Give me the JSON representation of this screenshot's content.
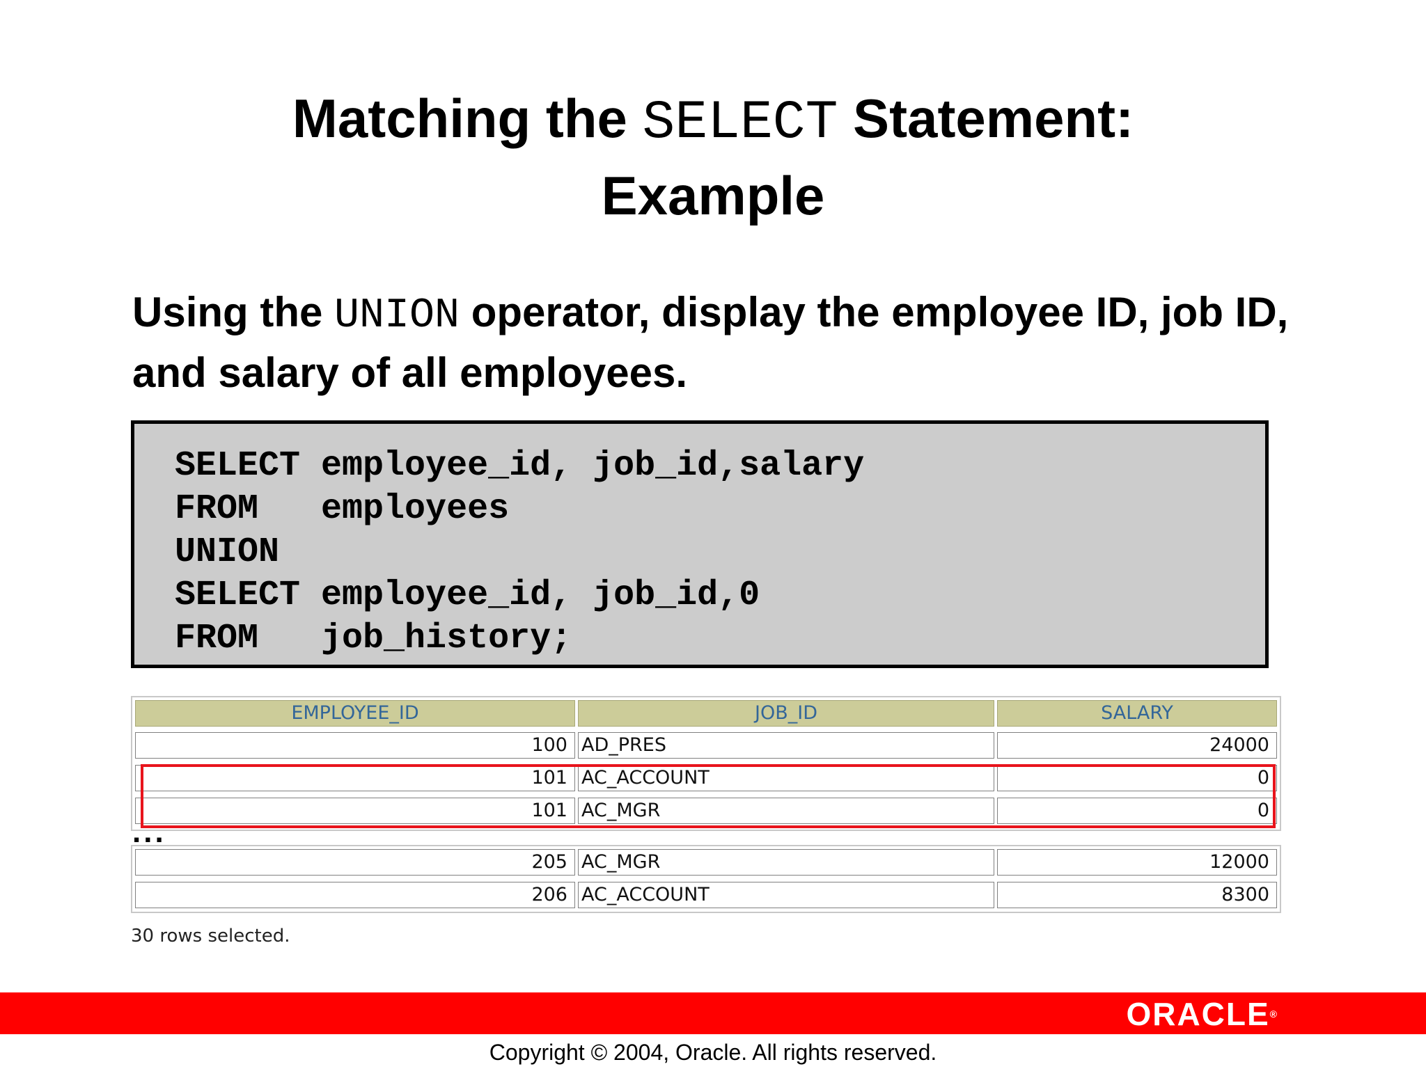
{
  "title": {
    "part1": "Matching the ",
    "keyword": "SELECT",
    "part2": " Statement:",
    "line2": "Example"
  },
  "intro": {
    "part1": "Using the ",
    "keyword": "UNION",
    "part2": " operator, display the employee ID, job ID, and salary of all employees."
  },
  "code": [
    "SELECT employee_id, job_id,salary",
    "FROM   employees",
    "UNION",
    "SELECT employee_id, job_id,0",
    "FROM   job_history;"
  ],
  "table": {
    "headers": [
      "EMPLOYEE_ID",
      "JOB_ID",
      "SALARY"
    ],
    "rows_top": [
      [
        "100",
        "AD_PRES",
        "24000"
      ],
      [
        "101",
        "AC_ACCOUNT",
        "0"
      ],
      [
        "101",
        "AC_MGR",
        "0"
      ]
    ],
    "ellipsis": "...",
    "rows_bottom": [
      [
        "205",
        "AC_MGR",
        "12000"
      ],
      [
        "206",
        "AC_ACCOUNT",
        "8300"
      ]
    ]
  },
  "rows_selected": "30 rows selected.",
  "logo": {
    "text": "ORACLE",
    "mark": "®"
  },
  "copyright": "Copyright © 2004, Oracle.  All rights reserved.",
  "colors": {
    "footer_bar": "#ff0000",
    "highlight_border": "#e8141c",
    "header_bg": "#cccc99",
    "header_text": "#336699",
    "code_bg": "#cccccc"
  }
}
